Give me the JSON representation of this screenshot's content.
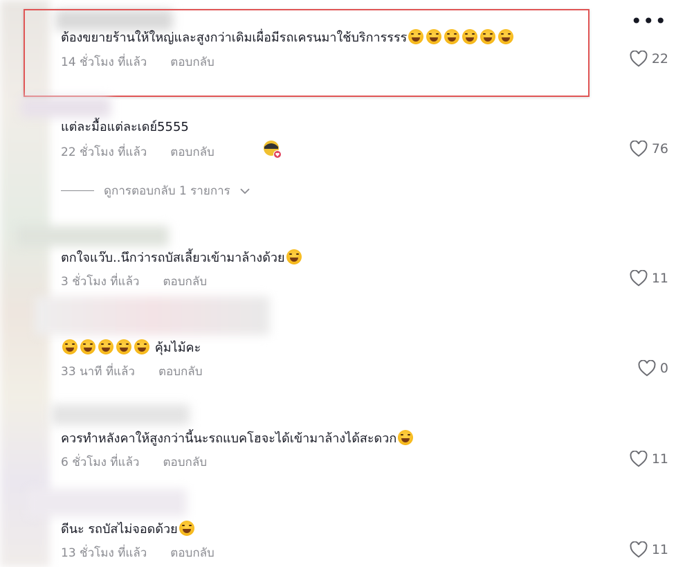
{
  "more_button": "•••",
  "comments": [
    {
      "text": "ต้องขยายร้านให้ใหญ่และสูงกว่าเดิมเผื่อมีรถเครนมาใช้บริการรรร",
      "time": "14 ชั่วโมง ที่แล้ว",
      "reply": "ตอบกลับ",
      "likes": "22"
    },
    {
      "text": "แต่ละมื้อแต่ละเดย์5555",
      "time": "22 ชั่วโมง ที่แล้ว",
      "reply": "ตอบกลับ",
      "likes": "76",
      "view_replies": "ดูการตอบกลับ 1 รายการ"
    },
    {
      "text": "ตกใจแว๊บ..นึกว่ารถบัสเลี้ยวเข้ามาล้างด้วย",
      "time": "3 ชั่วโมง ที่แล้ว",
      "reply": "ตอบกลับ",
      "likes": "11"
    },
    {
      "text": "คุ้มไม้คะ",
      "time": "33 นาที ที่แล้ว",
      "reply": "ตอบกลับ",
      "likes": "0"
    },
    {
      "text": "ควรทำหลังคาให้สูงกว่านี้นะรถแบคโฮจะได้เข้ามาล้างได้สะดวก",
      "time": "6 ชั่วโมง ที่แล้ว",
      "reply": "ตอบกลับ",
      "likes": "11"
    },
    {
      "text": "ดีนะ รถบัสไม่จอดด้วย",
      "time": "13 ชั่วโมง ที่แล้ว",
      "reply": "ตอบกลับ",
      "likes": "11"
    }
  ],
  "icons": {
    "like": "heart-outline-icon",
    "emoji_laugh": "grinning-sweat-icon",
    "chevron": "chevron-down-icon"
  },
  "colors": {
    "highlight_border": "#e05555",
    "meta_text": "#8a8b91",
    "body_text": "#161823"
  }
}
